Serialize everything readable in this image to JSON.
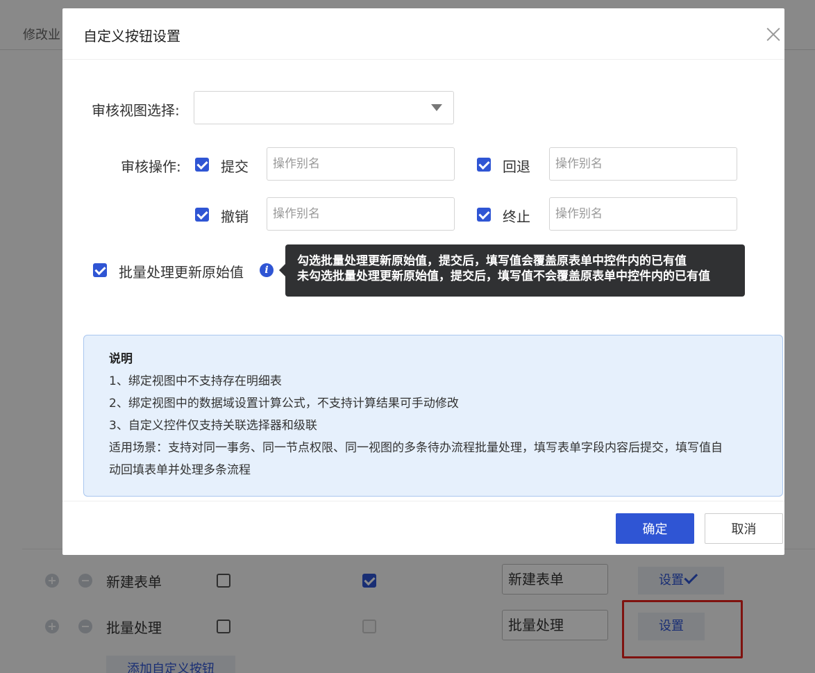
{
  "background": {
    "header_title": "修改业",
    "rows": [
      {
        "name": "新建表单",
        "alias": "新建表单",
        "set_label": "设置",
        "col2_checked": true
      },
      {
        "name": "批量处理",
        "alias": "批量处理",
        "set_label": "设置",
        "col2_checked": false
      }
    ],
    "add_button": "添加自定义按钮",
    "highlight_color": "#e8211d"
  },
  "modal": {
    "title": "自定义按钮设置",
    "view_select_label": "审核视图选择:",
    "view_select_value": "",
    "ops_label": "审核操作:",
    "ops": [
      {
        "label": "提交",
        "checked": true,
        "placeholder": "操作别名"
      },
      {
        "label": "回退",
        "checked": true,
        "placeholder": "操作别名"
      },
      {
        "label": "撤销",
        "checked": true,
        "placeholder": "操作别名"
      },
      {
        "label": "终止",
        "checked": true,
        "placeholder": "操作别名"
      }
    ],
    "batch_update_label": "批量处理更新原始值",
    "batch_update_checked": true,
    "tooltip": [
      "勾选批量处理更新原始值，提交后，填写值会覆盖原表单中控件内的已有值",
      "未勾选批量处理更新原始值，提交后，填写值不会覆盖原表单中控件内的已有值"
    ],
    "notice": {
      "title": "说明",
      "lines": [
        "1、绑定视图中不支持存在明细表",
        "2、绑定视图中的数据域设置计算公式，不支持计算结果可手动修改",
        "3、自定义控件仅支持关联选择器和级联",
        "适用场景：支持对同一事务、同一节点权限、同一视图的多条待办流程批量处理，填写表单字段内容后提交，填写值自",
        "动回填表单并处理多条流程"
      ]
    },
    "confirm_label": "确定",
    "cancel_label": "取消"
  },
  "colors": {
    "primary": "#2f55d4",
    "tooltip_bg": "#303133",
    "notice_bg": "#e6f0fc"
  }
}
